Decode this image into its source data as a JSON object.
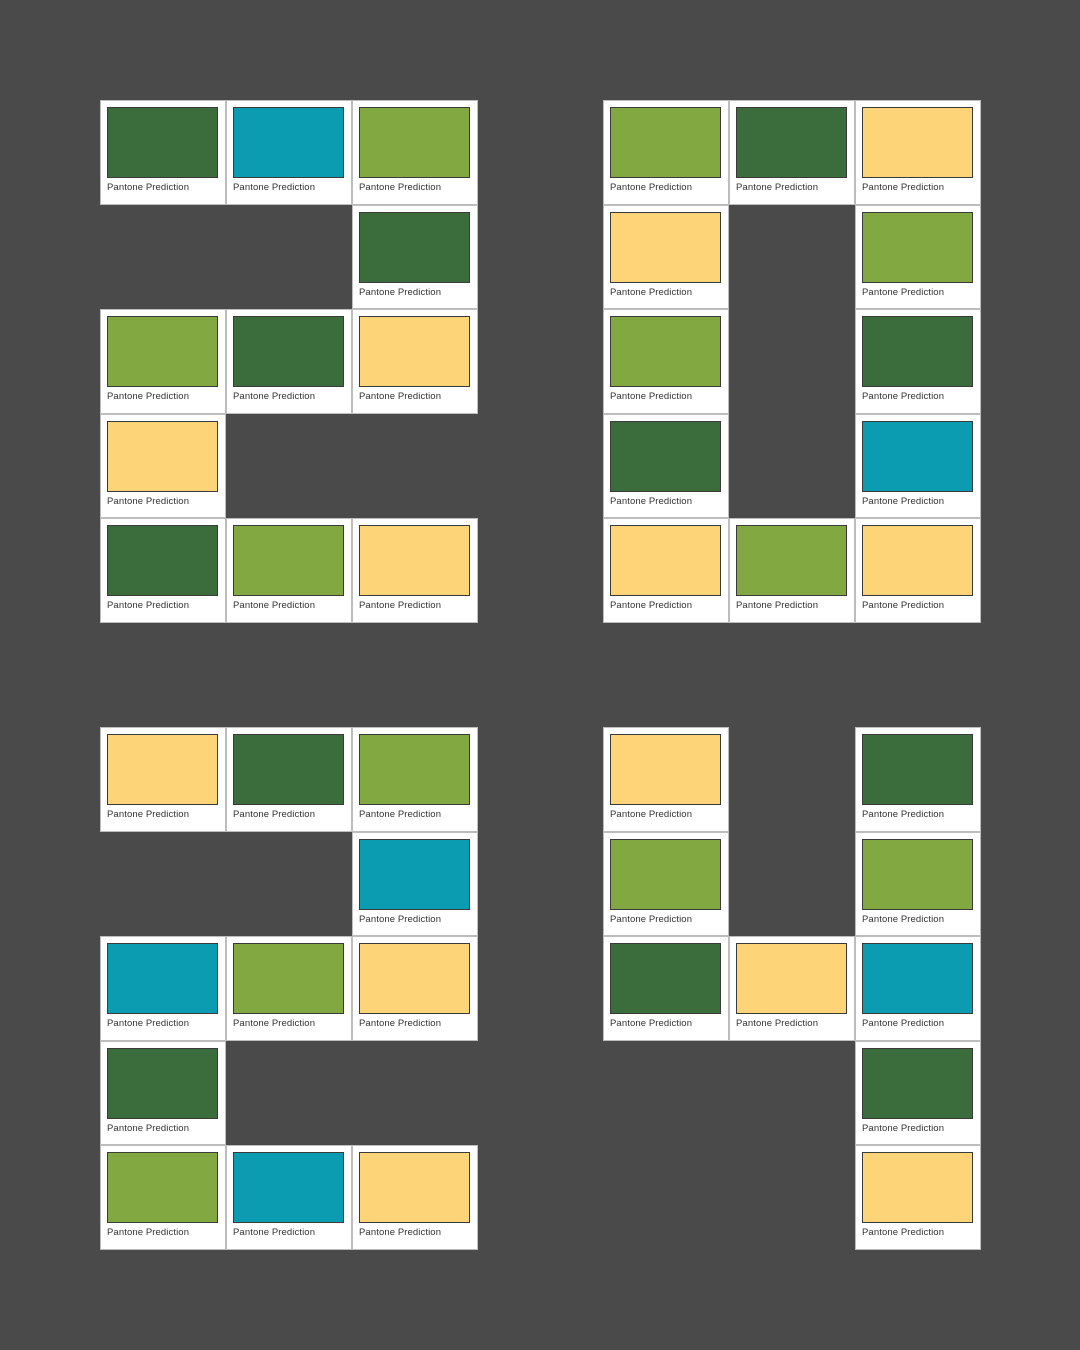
{
  "colors": {
    "dark_green": "#3b6c3c",
    "teal": "#0b9cb1",
    "light_green": "#82a842",
    "yellow": "#fed478",
    "background": "#4a4a4a",
    "card": "#ffffff"
  },
  "label_text": "Pantone Prediction",
  "digits": [
    {
      "name": "digit-2",
      "cells": [
        {
          "label": "Pantone Prediction",
          "color": "#3b6c3c"
        },
        {
          "label": "Pantone Prediction",
          "color": "#0b9cb1"
        },
        {
          "label": "Pantone Prediction",
          "color": "#82a842"
        },
        {
          "label": "Pantone Prediction",
          "color": "#3b6c3c"
        },
        {
          "label": "Pantone Prediction",
          "color": "#82a842"
        },
        {
          "label": "Pantone Prediction",
          "color": "#3b6c3c"
        },
        {
          "label": "Pantone Prediction",
          "color": "#fed478"
        },
        {
          "label": "Pantone Prediction",
          "color": "#fed478"
        },
        {
          "label": "Pantone Prediction",
          "color": "#3b6c3c"
        },
        {
          "label": "Pantone Prediction",
          "color": "#82a842"
        },
        {
          "label": "Pantone Prediction",
          "color": "#fed478"
        }
      ]
    },
    {
      "name": "digit-0",
      "cells": [
        {
          "label": "Pantone Prediction",
          "color": "#82a842"
        },
        {
          "label": "Pantone Prediction",
          "color": "#3b6c3c"
        },
        {
          "label": "Pantone Prediction",
          "color": "#fed478"
        },
        {
          "label": "Pantone Prediction",
          "color": "#fed478"
        },
        {
          "label": "Pantone Prediction",
          "color": "#82a842"
        },
        {
          "label": "Pantone Prediction",
          "color": "#82a842"
        },
        {
          "label": "Pantone Prediction",
          "color": "#3b6c3c"
        },
        {
          "label": "Pantone Prediction",
          "color": "#3b6c3c"
        },
        {
          "label": "Pantone Prediction",
          "color": "#0b9cb1"
        },
        {
          "label": "Pantone Prediction",
          "color": "#fed478"
        },
        {
          "label": "Pantone Prediction",
          "color": "#82a842"
        },
        {
          "label": "Pantone Prediction",
          "color": "#fed478"
        }
      ]
    },
    {
      "name": "digit-2-second",
      "cells": [
        {
          "label": "Pantone Prediction",
          "color": "#fed478"
        },
        {
          "label": "Pantone Prediction",
          "color": "#3b6c3c"
        },
        {
          "label": "Pantone Prediction",
          "color": "#82a842"
        },
        {
          "label": "Pantone Prediction",
          "color": "#0b9cb1"
        },
        {
          "label": "Pantone Prediction",
          "color": "#0b9cb1"
        },
        {
          "label": "Pantone Prediction",
          "color": "#82a842"
        },
        {
          "label": "Pantone Prediction",
          "color": "#fed478"
        },
        {
          "label": "Pantone Prediction",
          "color": "#3b6c3c"
        },
        {
          "label": "Pantone Prediction",
          "color": "#82a842"
        },
        {
          "label": "Pantone Prediction",
          "color": "#0b9cb1"
        },
        {
          "label": "Pantone Prediction",
          "color": "#fed478"
        }
      ]
    },
    {
      "name": "digit-4",
      "cells": [
        {
          "label": "Pantone Prediction",
          "color": "#fed478"
        },
        {
          "label": "Pantone Prediction",
          "color": "#3b6c3c"
        },
        {
          "label": "Pantone Prediction",
          "color": "#82a842"
        },
        {
          "label": "Pantone Prediction",
          "color": "#82a842"
        },
        {
          "label": "Pantone Prediction",
          "color": "#3b6c3c"
        },
        {
          "label": "Pantone Prediction",
          "color": "#fed478"
        },
        {
          "label": "Pantone Prediction",
          "color": "#0b9cb1"
        },
        {
          "label": "Pantone Prediction",
          "color": "#3b6c3c"
        },
        {
          "label": "Pantone Prediction",
          "color": "#fed478"
        }
      ]
    }
  ]
}
